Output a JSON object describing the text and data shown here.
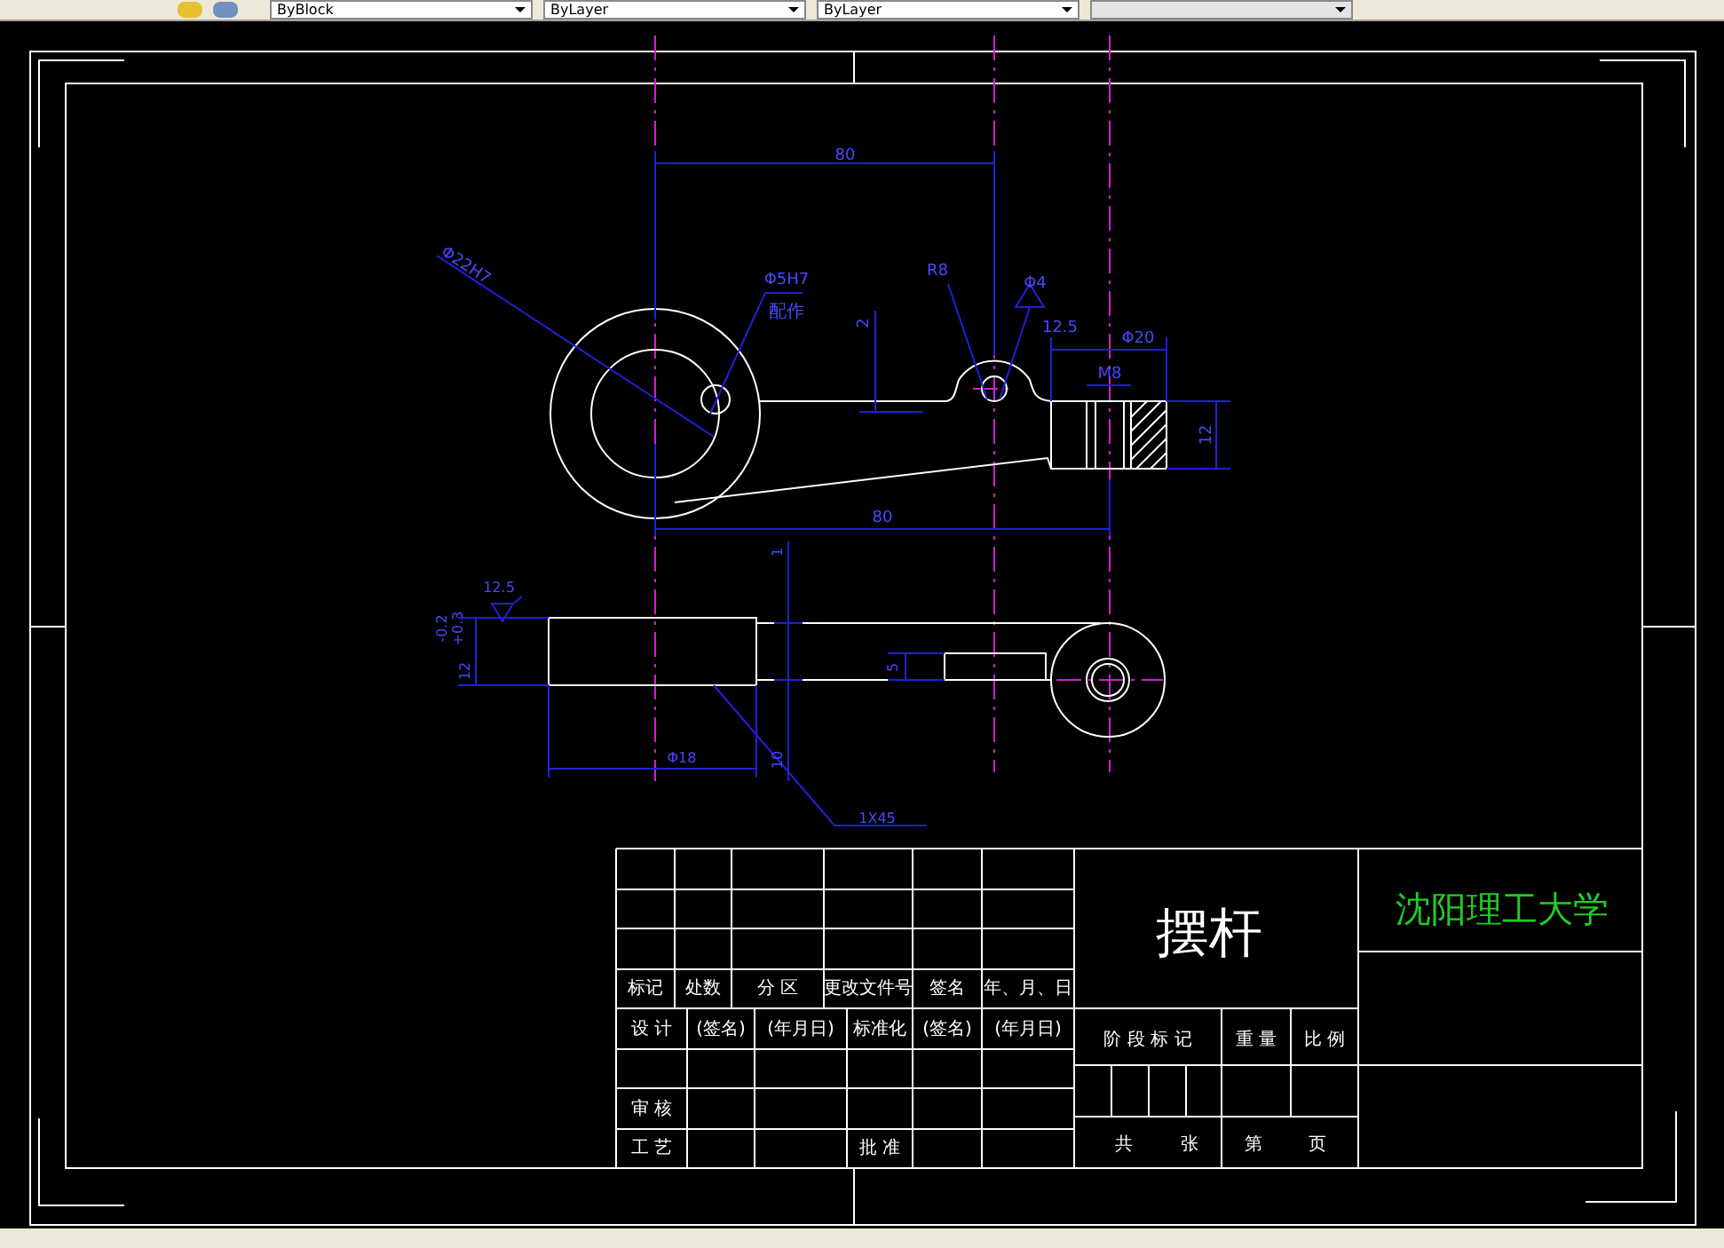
{
  "toolbar": {
    "dropdowns": [
      {
        "value": "ByBlock",
        "disabled": false
      },
      {
        "value": "ByLayer",
        "disabled": false
      },
      {
        "value": "ByLayer",
        "disabled": false
      },
      {
        "disabled": true
      }
    ]
  },
  "drawing": {
    "top_view_labels": [
      "80",
      "Φ22H7",
      "Φ5H7",
      "配作",
      "2",
      "R8",
      "Φ4",
      "12.5",
      "Φ20",
      "M8",
      "12",
      "80"
    ],
    "side_view_labels": [
      "12.5",
      "12",
      "-0.2",
      "+0.3",
      "1",
      "5",
      "Φ18",
      "10",
      "1X45"
    ]
  },
  "title_block": {
    "revision_header": [
      "标记",
      "处数",
      "分 区",
      "更改文件号",
      "签名",
      "年、月、日"
    ],
    "signature_row": [
      "设 计",
      "(签名)",
      "(年月日)",
      "标准化",
      "(签名)",
      "(年月日)"
    ],
    "review_label": "审 核",
    "process_label": "工 艺",
    "approve_label": "批 准",
    "part_name": "摆杆",
    "stage_labels": [
      "阶 段 标 记",
      "重 量",
      "比 例"
    ],
    "sheet_labels": [
      "共",
      "张",
      "第",
      "页"
    ],
    "school": "沈阳理工大学"
  }
}
